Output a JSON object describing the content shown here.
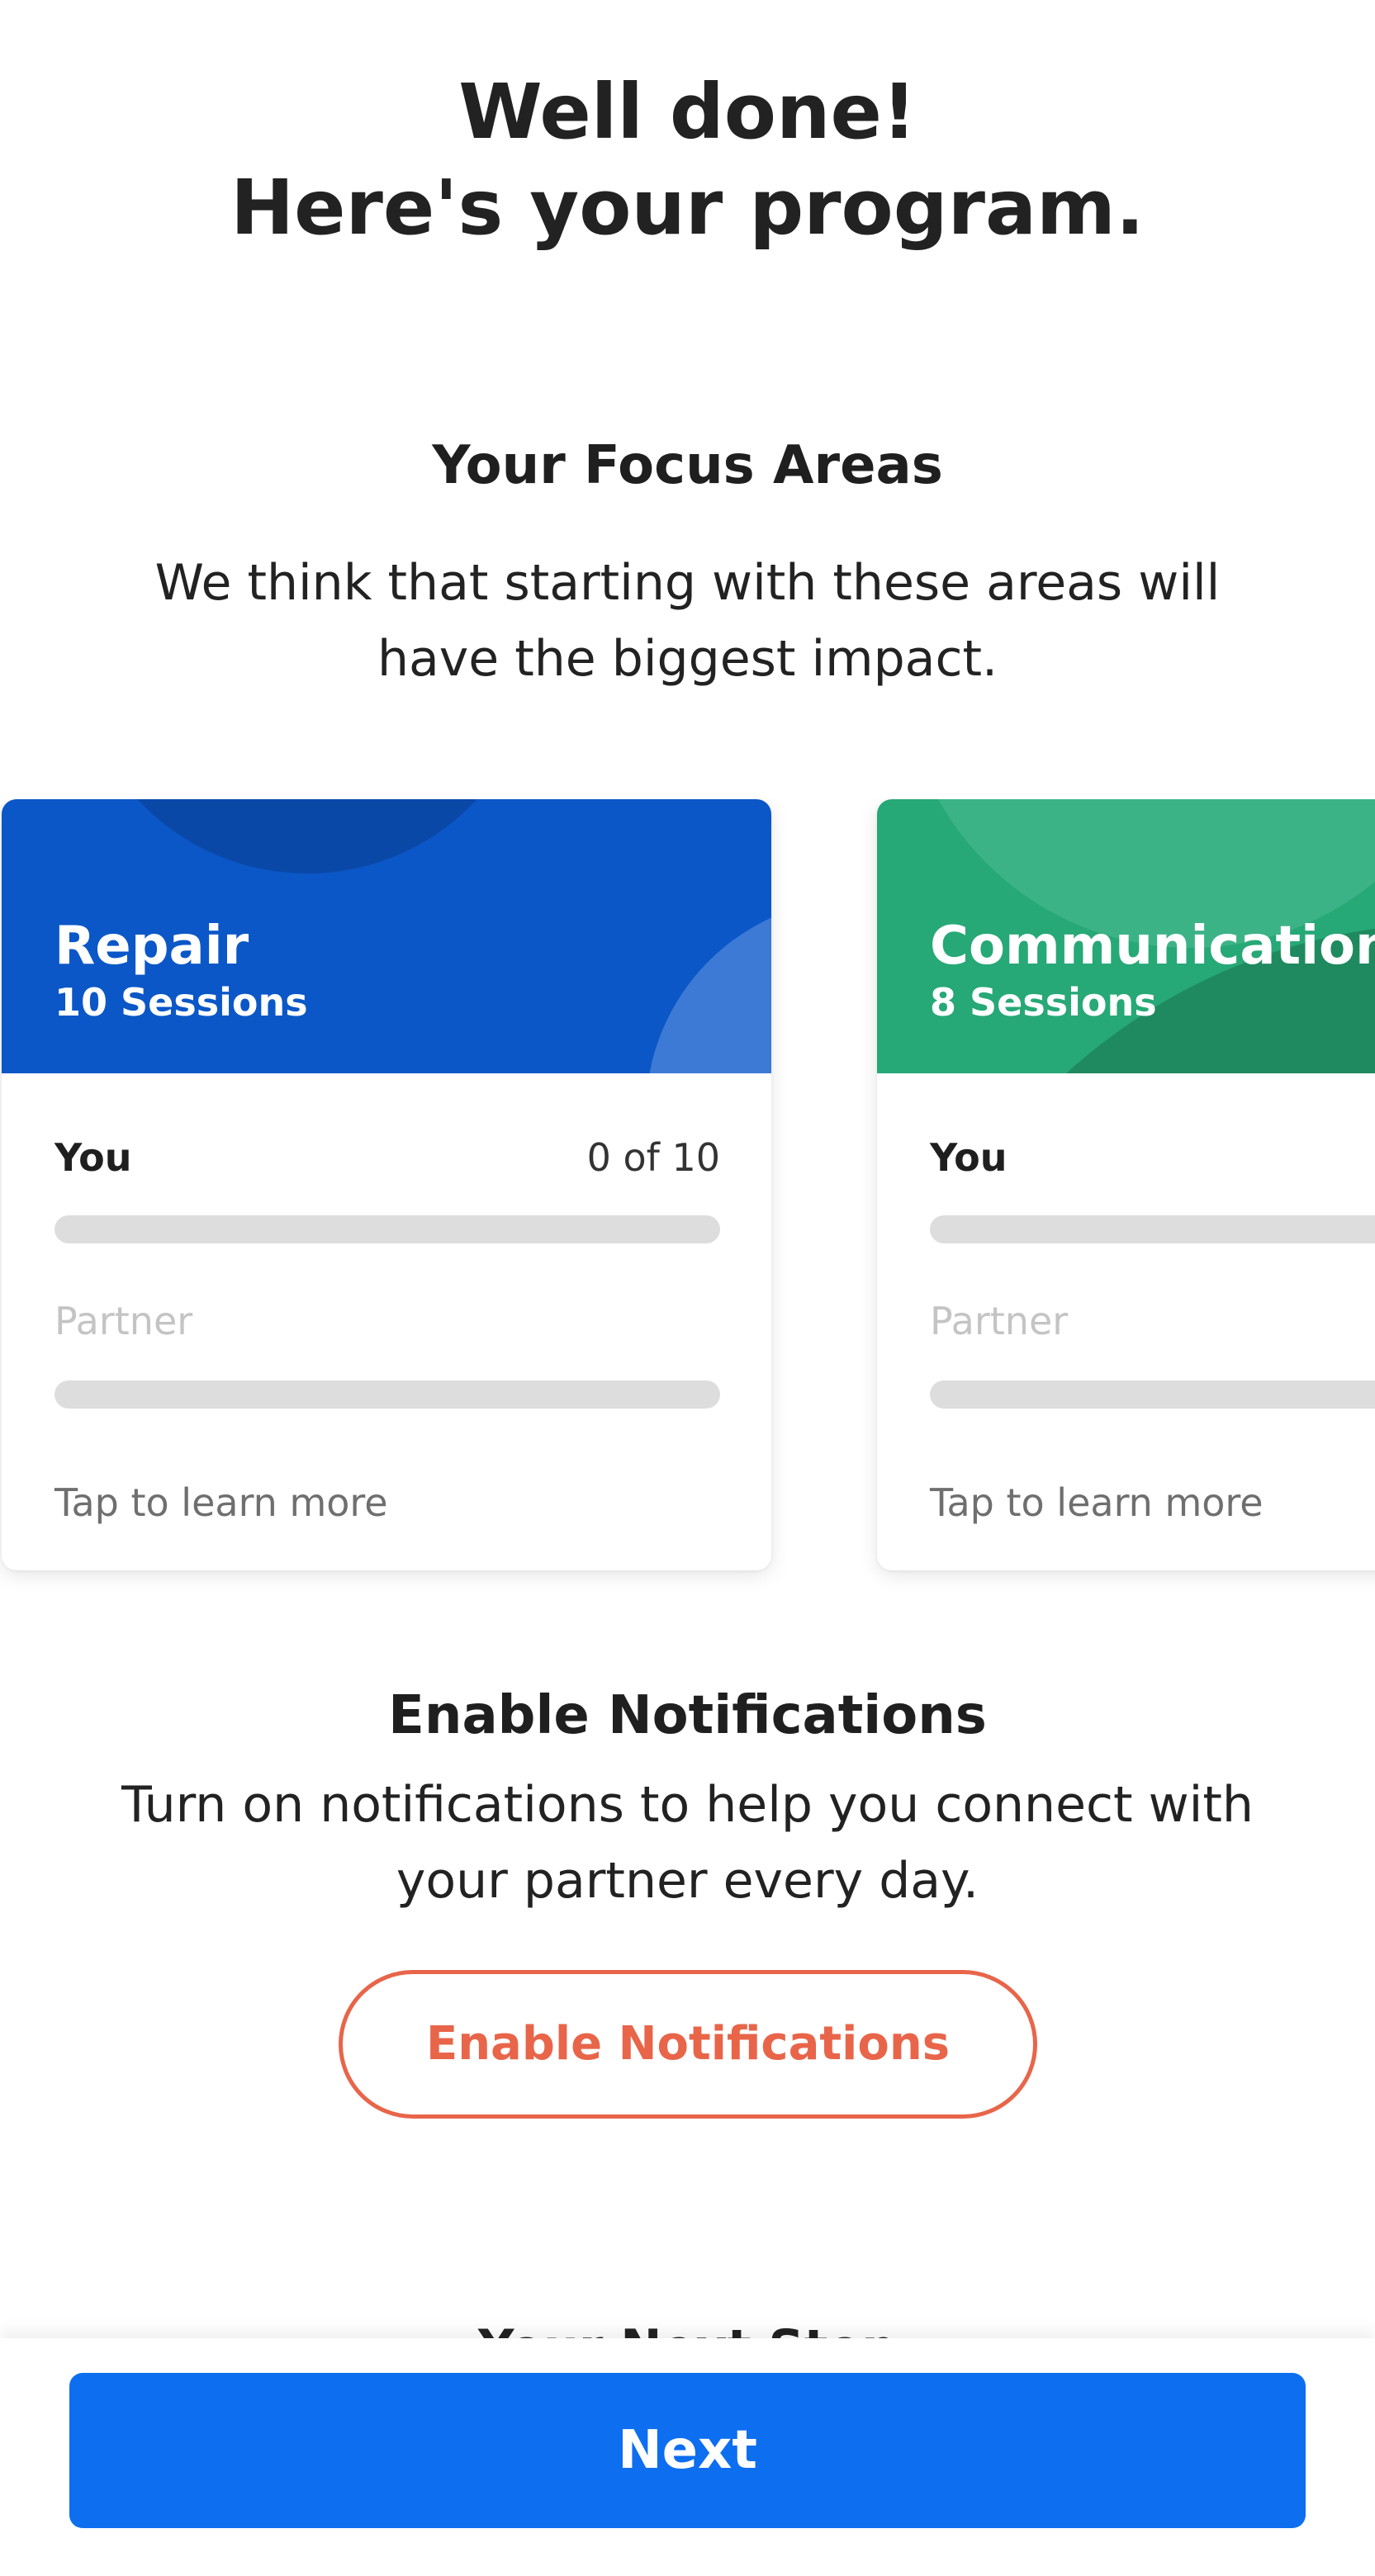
{
  "header": {
    "line1": "Well done!",
    "line2": "Here's your program."
  },
  "focus": {
    "title": "Your Focus Areas",
    "description": "We think that starting with these areas will have the biggest impact."
  },
  "cards": [
    {
      "name": "Repair",
      "sessions": "10 Sessions",
      "you_label": "You",
      "you_count": "0 of 10",
      "you_progress": 0,
      "partner_label": "Partner",
      "partner_progress": 0,
      "tap_text": "Tap to learn more",
      "color": "#0b57c7"
    },
    {
      "name": "Communication",
      "sessions": "8 Sessions",
      "you_label": "You",
      "you_progress": 0,
      "partner_label": "Partner",
      "partner_progress": 0,
      "tap_text": "Tap to learn more",
      "color": "#27a877"
    }
  ],
  "notifications": {
    "title": "Enable Notifications",
    "description": "Turn on notifications to help you connect with your partner every day.",
    "button_label": "Enable Notifications",
    "accent": "#e8654a"
  },
  "next_step": {
    "title": "Your Next Step"
  },
  "footer": {
    "next_label": "Next",
    "color": "#0d6ef0"
  }
}
